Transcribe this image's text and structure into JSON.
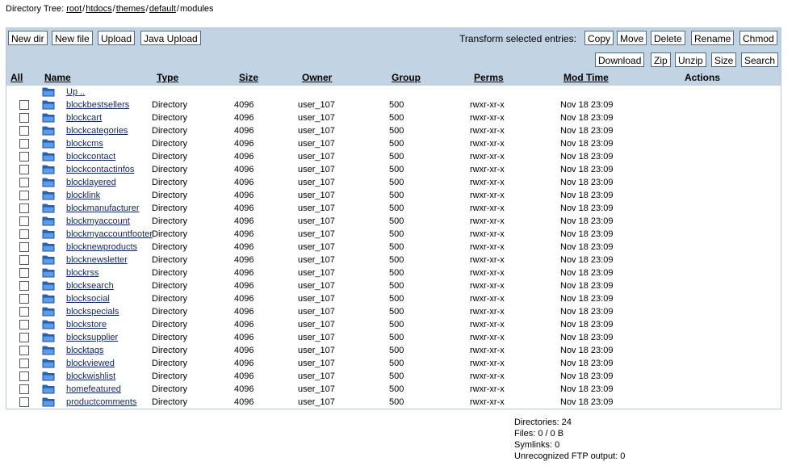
{
  "breadcrumb": {
    "label": "Directory Tree:",
    "links": [
      "root",
      "htdocs",
      "themes",
      "default"
    ],
    "current": "modules"
  },
  "toolbar": {
    "new_dir": "New dir",
    "new_file": "New file",
    "upload": "Upload",
    "java_upload": "Java Upload",
    "transform_label": "Transform selected entries:",
    "copy": "Copy",
    "move": "Move",
    "delete": "Delete",
    "rename": "Rename",
    "chmod": "Chmod",
    "download": "Download",
    "zip": "Zip",
    "unzip": "Unzip",
    "size": "Size",
    "search": "Search"
  },
  "columns": {
    "all": "All",
    "name": "Name",
    "type": "Type",
    "size": "Size",
    "owner": "Owner",
    "group": "Group",
    "perms": "Perms",
    "mod_time": "Mod Time",
    "actions": "Actions"
  },
  "up_label": "Up ..",
  "rows": [
    {
      "name": "blockbestsellers",
      "type": "Directory",
      "size": "4096",
      "owner": "user_107",
      "group": "500",
      "perms": "rwxr-xr-x",
      "mod": "Nov 18 23:09"
    },
    {
      "name": "blockcart",
      "type": "Directory",
      "size": "4096",
      "owner": "user_107",
      "group": "500",
      "perms": "rwxr-xr-x",
      "mod": "Nov 18 23:09"
    },
    {
      "name": "blockcategories",
      "type": "Directory",
      "size": "4096",
      "owner": "user_107",
      "group": "500",
      "perms": "rwxr-xr-x",
      "mod": "Nov 18 23:09"
    },
    {
      "name": "blockcms",
      "type": "Directory",
      "size": "4096",
      "owner": "user_107",
      "group": "500",
      "perms": "rwxr-xr-x",
      "mod": "Nov 18 23:09"
    },
    {
      "name": "blockcontact",
      "type": "Directory",
      "size": "4096",
      "owner": "user_107",
      "group": "500",
      "perms": "rwxr-xr-x",
      "mod": "Nov 18 23:09"
    },
    {
      "name": "blockcontactinfos",
      "type": "Directory",
      "size": "4096",
      "owner": "user_107",
      "group": "500",
      "perms": "rwxr-xr-x",
      "mod": "Nov 18 23:09"
    },
    {
      "name": "blocklayered",
      "type": "Directory",
      "size": "4096",
      "owner": "user_107",
      "group": "500",
      "perms": "rwxr-xr-x",
      "mod": "Nov 18 23:09"
    },
    {
      "name": "blocklink",
      "type": "Directory",
      "size": "4096",
      "owner": "user_107",
      "group": "500",
      "perms": "rwxr-xr-x",
      "mod": "Nov 18 23:09"
    },
    {
      "name": "blockmanufacturer",
      "type": "Directory",
      "size": "4096",
      "owner": "user_107",
      "group": "500",
      "perms": "rwxr-xr-x",
      "mod": "Nov 18 23:09"
    },
    {
      "name": "blockmyaccount",
      "type": "Directory",
      "size": "4096",
      "owner": "user_107",
      "group": "500",
      "perms": "rwxr-xr-x",
      "mod": "Nov 18 23:09"
    },
    {
      "name": "blockmyaccountfooter",
      "type": "Directory",
      "size": "4096",
      "owner": "user_107",
      "group": "500",
      "perms": "rwxr-xr-x",
      "mod": "Nov 18 23:09"
    },
    {
      "name": "blocknewproducts",
      "type": "Directory",
      "size": "4096",
      "owner": "user_107",
      "group": "500",
      "perms": "rwxr-xr-x",
      "mod": "Nov 18 23:09"
    },
    {
      "name": "blocknewsletter",
      "type": "Directory",
      "size": "4096",
      "owner": "user_107",
      "group": "500",
      "perms": "rwxr-xr-x",
      "mod": "Nov 18 23:09"
    },
    {
      "name": "blockrss",
      "type": "Directory",
      "size": "4096",
      "owner": "user_107",
      "group": "500",
      "perms": "rwxr-xr-x",
      "mod": "Nov 18 23:09"
    },
    {
      "name": "blocksearch",
      "type": "Directory",
      "size": "4096",
      "owner": "user_107",
      "group": "500",
      "perms": "rwxr-xr-x",
      "mod": "Nov 18 23:09"
    },
    {
      "name": "blocksocial",
      "type": "Directory",
      "size": "4096",
      "owner": "user_107",
      "group": "500",
      "perms": "rwxr-xr-x",
      "mod": "Nov 18 23:09"
    },
    {
      "name": "blockspecials",
      "type": "Directory",
      "size": "4096",
      "owner": "user_107",
      "group": "500",
      "perms": "rwxr-xr-x",
      "mod": "Nov 18 23:09"
    },
    {
      "name": "blockstore",
      "type": "Directory",
      "size": "4096",
      "owner": "user_107",
      "group": "500",
      "perms": "rwxr-xr-x",
      "mod": "Nov 18 23:09"
    },
    {
      "name": "blocksupplier",
      "type": "Directory",
      "size": "4096",
      "owner": "user_107",
      "group": "500",
      "perms": "rwxr-xr-x",
      "mod": "Nov 18 23:09"
    },
    {
      "name": "blocktags",
      "type": "Directory",
      "size": "4096",
      "owner": "user_107",
      "group": "500",
      "perms": "rwxr-xr-x",
      "mod": "Nov 18 23:09"
    },
    {
      "name": "blockviewed",
      "type": "Directory",
      "size": "4096",
      "owner": "user_107",
      "group": "500",
      "perms": "rwxr-xr-x",
      "mod": "Nov 18 23:09"
    },
    {
      "name": "blockwishlist",
      "type": "Directory",
      "size": "4096",
      "owner": "user_107",
      "group": "500",
      "perms": "rwxr-xr-x",
      "mod": "Nov 18 23:09"
    },
    {
      "name": "homefeatured",
      "type": "Directory",
      "size": "4096",
      "owner": "user_107",
      "group": "500",
      "perms": "rwxr-xr-x",
      "mod": "Nov 18 23:09"
    },
    {
      "name": "productcomments",
      "type": "Directory",
      "size": "4096",
      "owner": "user_107",
      "group": "500",
      "perms": "rwxr-xr-x",
      "mod": "Nov 18 23:09"
    }
  ],
  "summary": {
    "directories": "Directories: 24",
    "files": "Files: 0 / 0 B",
    "symlinks": "Symlinks: 0",
    "unrecognized": "Unrecognized FTP output: 0"
  },
  "icons": {
    "folder": "folder-icon"
  },
  "colors": {
    "toolbar_bg": "#c2d4e3",
    "folder_blue": "#2a6fcf",
    "link": "#0b2a5b"
  }
}
